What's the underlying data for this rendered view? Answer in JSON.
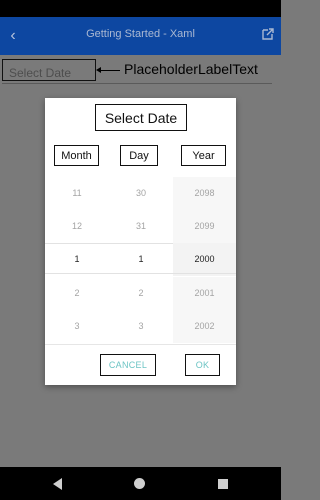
{
  "app_bar": {
    "title": "Getting Started - Xaml",
    "back_icon": "chevron-left-icon",
    "external_icon": "open-external-icon"
  },
  "date_field": {
    "placeholder": "Select Date"
  },
  "callout": {
    "label": "PlaceholderLabelText"
  },
  "dialog": {
    "title": "Select Date",
    "columns": {
      "month": "Month",
      "day": "Day",
      "year": "Year"
    },
    "rows": [
      {
        "month": "11",
        "day": "30",
        "year": "2098"
      },
      {
        "month": "12",
        "day": "31",
        "year": "2099"
      },
      {
        "month": "1",
        "day": "1",
        "year": "2000"
      },
      {
        "month": "2",
        "day": "2",
        "year": "2001"
      },
      {
        "month": "3",
        "day": "3",
        "year": "2002"
      }
    ],
    "cancel_label": "CANCEL",
    "ok_label": "OK"
  },
  "colors": {
    "app_bar": "#0d47a1",
    "overlay": "#7a7a7a",
    "button_text": "#6cc4c4"
  }
}
